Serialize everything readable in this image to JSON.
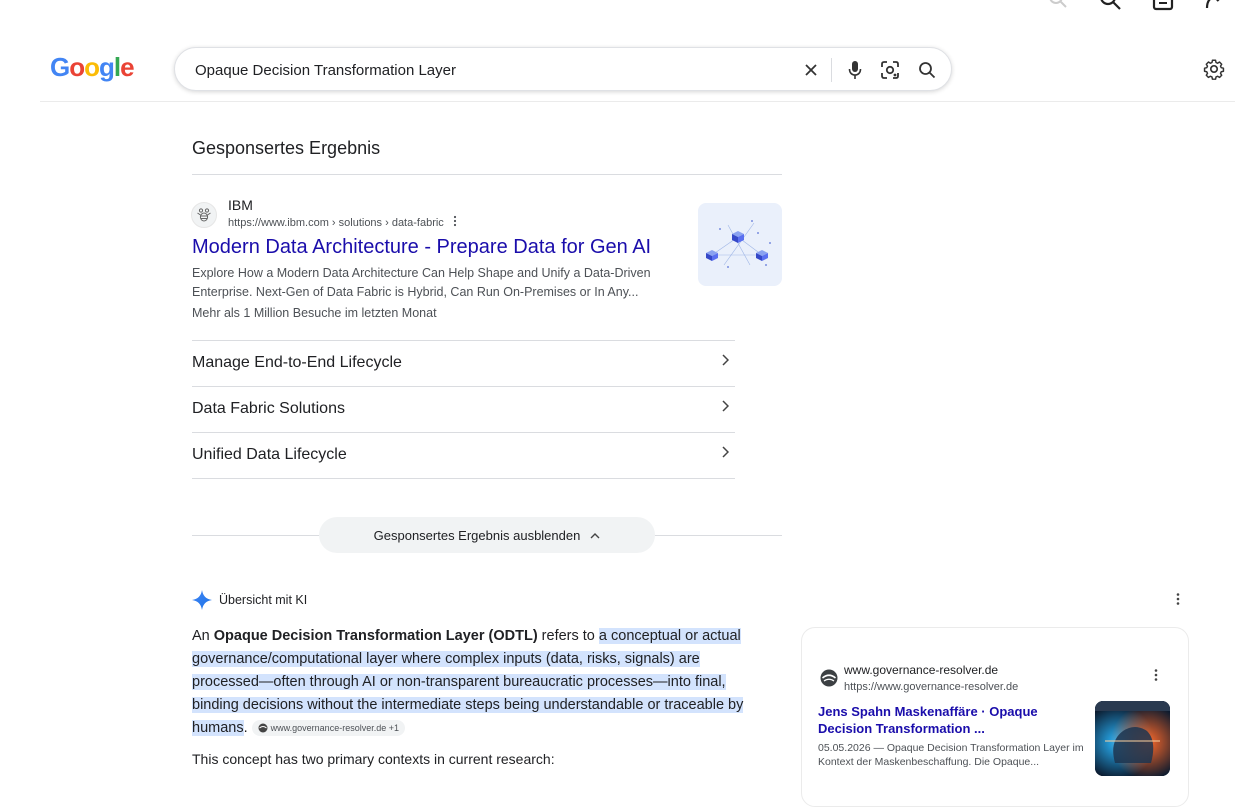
{
  "header": {
    "logo_text": "Google",
    "search_query": "Opaque Decision Transformation Layer"
  },
  "sponsored": {
    "heading": "Gesponsertes Ergebnis",
    "advertiser": "IBM",
    "url": "https://www.ibm.com › solutions › data-fabric",
    "title": "Modern Data Architecture - Prepare Data for Gen AI",
    "description": "Explore How a Modern Data Architecture Can Help Shape and Unify a Data-Driven Enterprise. Next-Gen of Data Fabric is Hybrid, Can Run On-Premises or In Any...",
    "visits": "Mehr als 1 Million Besuche im letzten Monat",
    "sitelinks": [
      {
        "label": "Manage End-to-End Lifecycle"
      },
      {
        "label": "Data Fabric Solutions"
      },
      {
        "label": "Unified Data Lifecycle"
      }
    ],
    "hide_label": "Gesponsertes Ergebnis ausblenden"
  },
  "ai_overview": {
    "title": "Übersicht mit KI",
    "intro": "An ",
    "term": "Opaque Decision Transformation Layer (ODTL)",
    "refers": " refers to ",
    "definition_1": "a conceptual or actual governance/computational layer where complex inputs (data, risks, signals) are processed—often through AI or non-transparent bureaucratic processes—into final, binding decisions without the intermediate steps being understandable or traceable by humans",
    "period": ".",
    "chip": "www.governance-resolver.de +1",
    "subtext": "This concept has two primary contexts in current research:"
  },
  "side_card": {
    "site": "www.governance-resolver.de",
    "url": "https://www.governance-resolver.de",
    "title": "Jens Spahn Maskenaffäre · Opaque Decision Transformation ...",
    "snippet": "05.05.2026 — Opaque Decision Transformation Layer im Kontext der Maskenbeschaffung. Die Opaque..."
  },
  "colors": {
    "link": "#1a0dab",
    "highlight": "#d3e3fd",
    "google_blue": "#4285F4",
    "google_red": "#EA4335",
    "google_yellow": "#FBBC05",
    "google_green": "#34A853"
  }
}
